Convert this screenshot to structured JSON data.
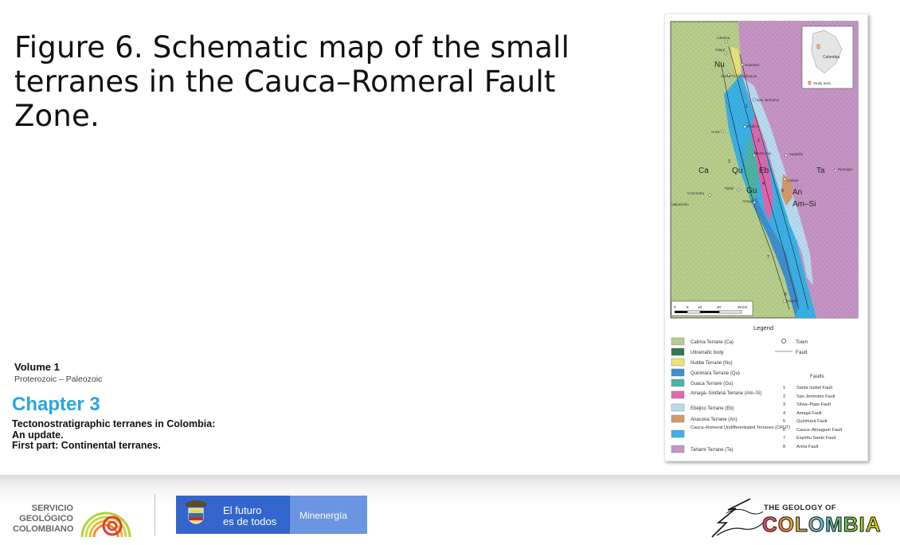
{
  "slide": {
    "title": "Figure 6. Schematic map of the small terranes in the Cauca–Romeral Fault Zone.",
    "volume": "Volume 1",
    "era": "Proterozoic – Paleozoic",
    "chapter": "Chapter 3",
    "subtitle_lines": [
      "Tectonostratigraphic terranes in Colombia:",
      "An update.",
      "First part: Continental terranes."
    ]
  },
  "map": {
    "terrane_labels": [
      "Ca",
      "Nu",
      "Qu",
      "Gu",
      "Eb",
      "An",
      "Am–Si",
      "Ta"
    ],
    "towns": [
      "Liborina",
      "Olaya",
      "Sopetrán",
      "Santa Fe de Antioquia",
      "San Jerónimo",
      "Ebéjico",
      "Anzá",
      "Heliconia",
      "Medellín",
      "Rionegro",
      "Caldas",
      "Titiribí",
      "Concordia",
      "Amagá",
      "Salgar",
      "Valparaíso"
    ],
    "inset_labels": [
      "Colombia",
      "Study area"
    ],
    "scale_ticks": [
      "0",
      "5",
      "10",
      "20",
      "30 km"
    ],
    "fault_numbers": [
      "1",
      "2",
      "3",
      "4",
      "5",
      "6",
      "7",
      "8"
    ]
  },
  "legend": {
    "title": "Legend",
    "terranes": [
      {
        "label": "Calima Terrane (Ca)",
        "color": "#b8cf8c"
      },
      {
        "label": "Ultramafic body",
        "color": "#2f7a4f"
      },
      {
        "label": "Nutibe Terrane (Nu)",
        "color": "#e9e27a"
      },
      {
        "label": "Quirimará Terrane (Qu)",
        "color": "#3f8fd0"
      },
      {
        "label": "Guaca Terrane (Gu)",
        "color": "#4bb5a6"
      },
      {
        "label": "Amagá–Sinifaná Terrane (Am–Si)",
        "color": "#e067ae"
      },
      {
        "label": "Ebéjico Terrane (Eb)",
        "color": "#b9dcef"
      },
      {
        "label": "Anacona Terrane (An)",
        "color": "#d39a6a"
      },
      {
        "label": "Cauca–Romeral Undifferentiated Terranes (CRUT)",
        "color": "#3bb1e6"
      },
      {
        "label": "Tahamí Terrane (Ta)",
        "color": "#c795c6"
      }
    ],
    "symbols": {
      "town": "Town",
      "fault": "Fault"
    },
    "faults_title": "Faults",
    "faults": [
      {
        "n": "1",
        "name": "Santa Isabel Fault"
      },
      {
        "n": "2",
        "name": "San Jerónimo Fault"
      },
      {
        "n": "3",
        "name": "Silvia–Pijao Fault"
      },
      {
        "n": "4",
        "name": "Amagá Fault"
      },
      {
        "n": "5",
        "name": "Quirimará Fault"
      },
      {
        "n": "6",
        "name": "Cauca–Almaguer Fault"
      },
      {
        "n": "7",
        "name": "Espíritu Santo Fault"
      },
      {
        "n": "8",
        "name": "Arma Fault"
      }
    ]
  },
  "footer": {
    "sgc_lines": [
      "SERVICIO",
      "GEOLÓGICO",
      "COLOMBIANO"
    ],
    "gov_lines": [
      "El futuro",
      "es de todos"
    ],
    "ministry": "Minenergía",
    "geology_of": "THE GEOLOGY OF",
    "colombia": "COLOMBIA"
  },
  "colors": {
    "accent": "#2aa6dc",
    "gov_blue": "#3366cc",
    "mine_blue": "#6b95e0"
  }
}
